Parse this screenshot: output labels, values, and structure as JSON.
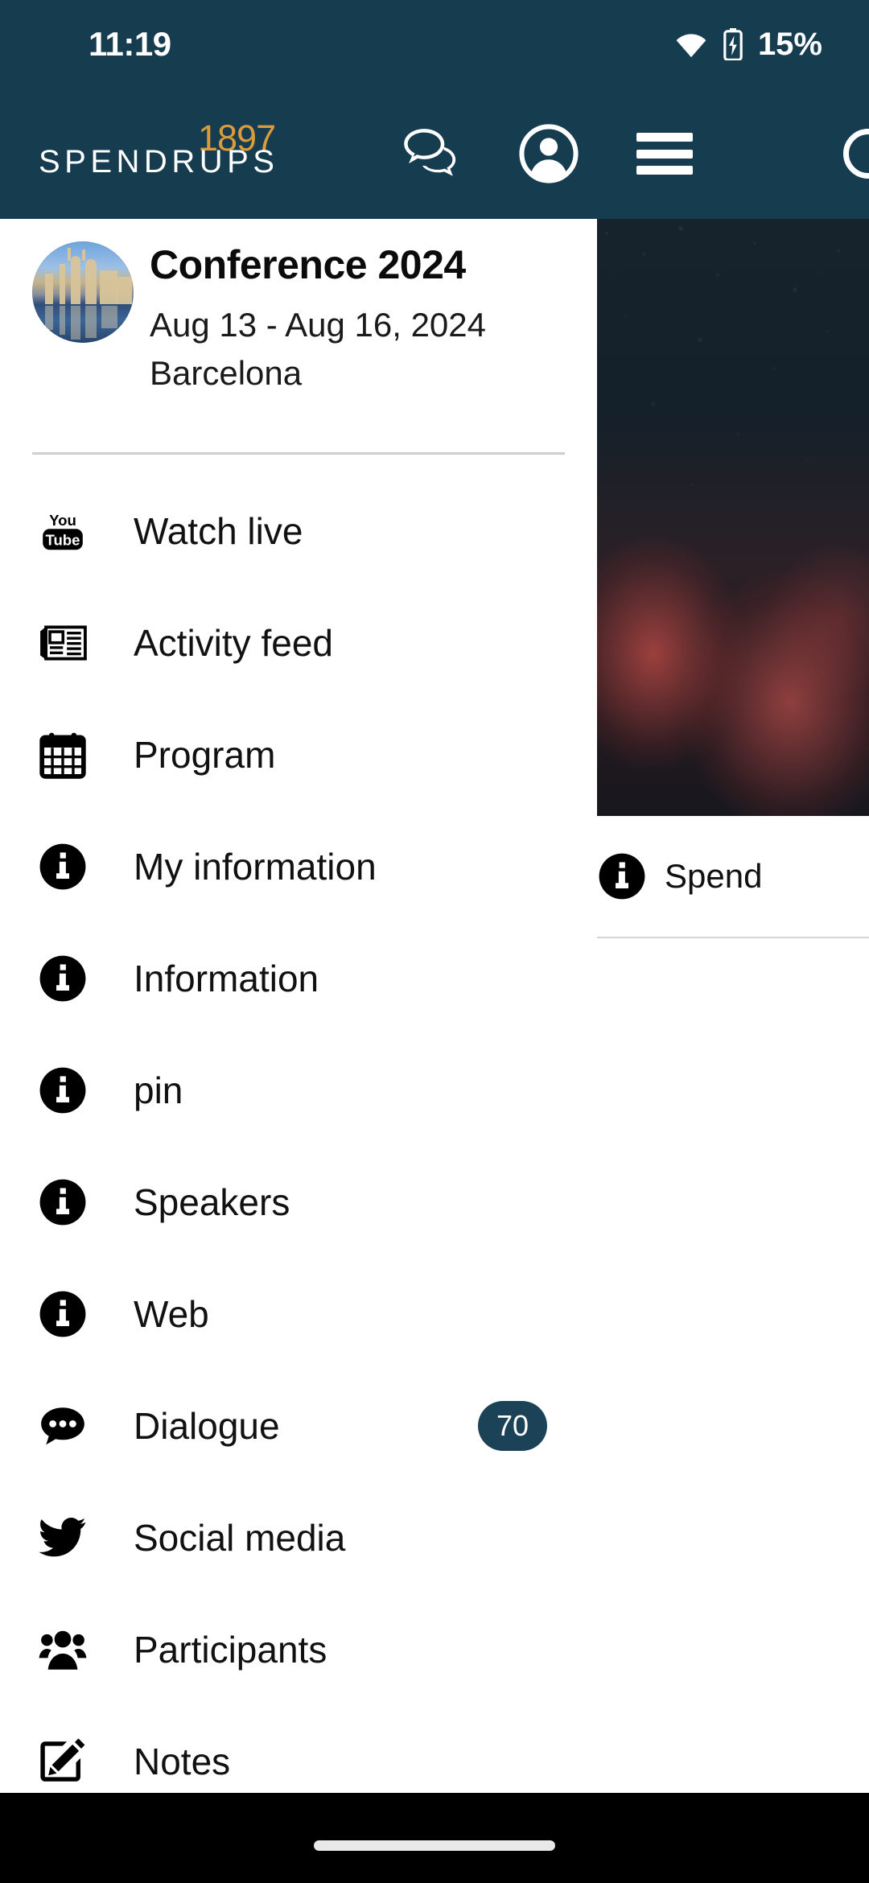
{
  "status_bar": {
    "time": "11:19",
    "battery_text": "15%",
    "wifi_icon": "wifi-icon",
    "battery_icon": "battery-charging-icon"
  },
  "app_bar": {
    "brand_name": "SPENDRUPS",
    "brand_year": "1897",
    "brand_color": "#D99B3C",
    "bar_color": "#153C4F",
    "actions": [
      {
        "name": "chat-bubbles-icon",
        "label": "Chat"
      },
      {
        "name": "account-circle-icon",
        "label": "Account"
      },
      {
        "name": "hamburger-menu-icon",
        "label": "Menu"
      }
    ]
  },
  "drawer": {
    "event": {
      "title": "Conference 2024",
      "dates": "Aug 13 - Aug 16, 2024",
      "location": "Barcelona",
      "avatar_icon": "city-waterfront-photo"
    },
    "menu": [
      {
        "label": "Watch live",
        "icon": "youtube-icon",
        "badge": null
      },
      {
        "label": "Activity feed",
        "icon": "newspaper-icon",
        "badge": null
      },
      {
        "label": "Program",
        "icon": "calendar-icon",
        "badge": null
      },
      {
        "label": "My information",
        "icon": "info-circle-icon",
        "badge": null
      },
      {
        "label": "Information",
        "icon": "info-circle-icon",
        "badge": null
      },
      {
        "label": "pin",
        "icon": "info-circle-icon",
        "badge": null
      },
      {
        "label": "Speakers",
        "icon": "info-circle-icon",
        "badge": null
      },
      {
        "label": "Web",
        "icon": "info-circle-icon",
        "badge": null
      },
      {
        "label": "Dialogue",
        "icon": "chat-dots-icon",
        "badge": "70"
      },
      {
        "label": "Social media",
        "icon": "twitter-bird-icon",
        "badge": null
      },
      {
        "label": "Participants",
        "icon": "people-group-icon",
        "badge": null
      },
      {
        "label": "Notes",
        "icon": "pencil-square-icon",
        "badge": null
      }
    ],
    "badge_color": "#1B4257"
  },
  "content": {
    "hero_icon": "crowd-photo",
    "list_item_label": "Spend",
    "list_item_icon": "info-circle-icon"
  },
  "nav_bar": {
    "gesture_pill": "home-gesture-pill"
  }
}
